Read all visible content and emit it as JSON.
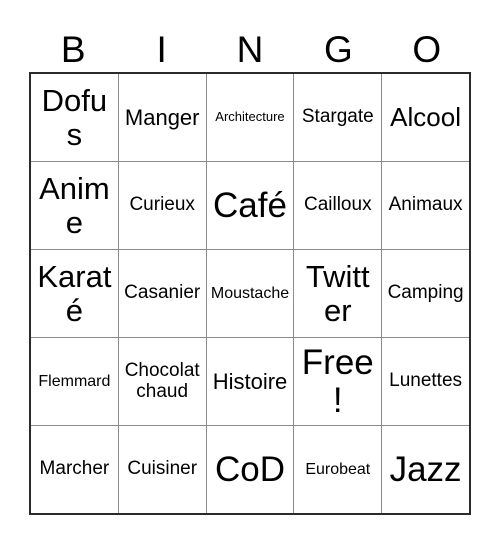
{
  "card": {
    "title": "BINGO",
    "background_color": "#ffffff",
    "text_color": "#000000",
    "outer_border_color": "#2b2b2b",
    "inner_grid_color": "#8c8c8c"
  },
  "header": {
    "letters": [
      "B",
      "I",
      "N",
      "G",
      "O"
    ]
  },
  "grid": {
    "columns": 5,
    "rows": 5,
    "cells": [
      [
        {
          "text": "Dofus",
          "size": "xxl"
        },
        {
          "text": "Manger",
          "size": "lg"
        },
        {
          "text": "Architecture",
          "size": "xs"
        },
        {
          "text": "Stargate",
          "size": "md"
        },
        {
          "text": "Alcool",
          "size": "xl"
        }
      ],
      [
        {
          "text": "Anime",
          "size": "xxl"
        },
        {
          "text": "Curieux",
          "size": "md"
        },
        {
          "text": "Café",
          "size": "huge"
        },
        {
          "text": "Cailloux",
          "size": "md"
        },
        {
          "text": "Animaux",
          "size": "md"
        }
      ],
      [
        {
          "text": "Karaté",
          "size": "xxl"
        },
        {
          "text": "Casanier",
          "size": "md"
        },
        {
          "text": "Moustache",
          "size": "sm"
        },
        {
          "text": "Twitter",
          "size": "xxl"
        },
        {
          "text": "Camping",
          "size": "md"
        }
      ],
      [
        {
          "text": "Flemmard",
          "size": "sm"
        },
        {
          "text": "Chocolat chaud",
          "size": "md"
        },
        {
          "text": "Histoire",
          "size": "lg"
        },
        {
          "text": "Free!",
          "size": "huge"
        },
        {
          "text": "Lunettes",
          "size": "md"
        }
      ],
      [
        {
          "text": "Marcher",
          "size": "md"
        },
        {
          "text": "Cuisiner",
          "size": "md"
        },
        {
          "text": "CoD",
          "size": "huge"
        },
        {
          "text": "Eurobeat",
          "size": "sm"
        },
        {
          "text": "Jazz",
          "size": "huge"
        }
      ]
    ]
  }
}
